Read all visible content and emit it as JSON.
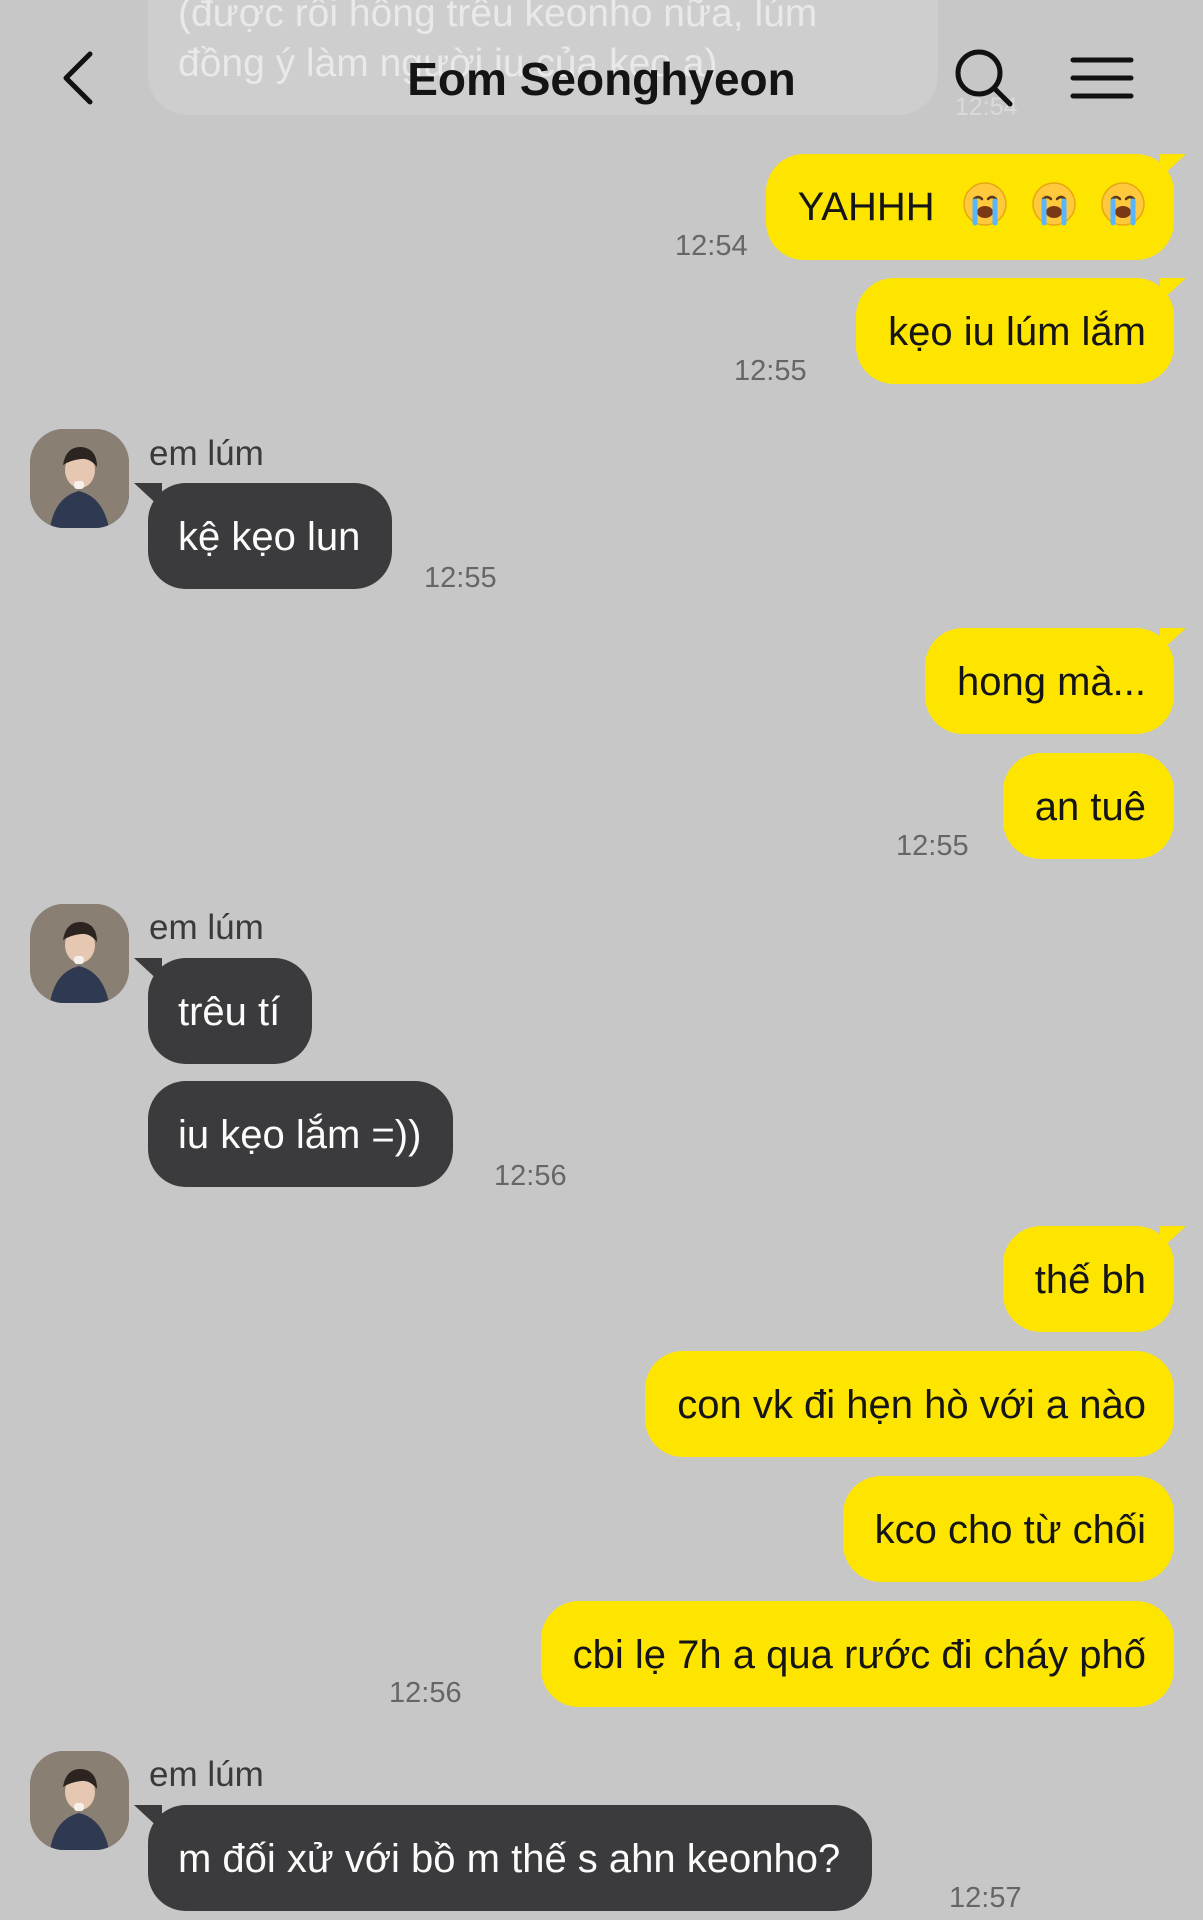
{
  "header": {
    "title": "Eom Seonghyeon",
    "ghost_message": "(được rồi hông trêu keonho nữa, lúm đồng ý làm người iu của kẹo a)",
    "ghost_time": "12:54"
  },
  "messages": [
    {
      "id": "m1",
      "sender": "me",
      "text": "YAHHH",
      "emoji": [
        "😭",
        "😭",
        "😭"
      ],
      "time": "12:54"
    },
    {
      "id": "m2",
      "sender": "me",
      "text": "kẹo iu lúm lắm",
      "time": "12:55"
    },
    {
      "id": "m3",
      "sender": "them",
      "name": "em lúm",
      "text": "kệ kẹo lun",
      "time": "12:55"
    },
    {
      "id": "m4",
      "sender": "me",
      "text": "hong mà..."
    },
    {
      "id": "m5",
      "sender": "me",
      "text": "an tuê",
      "time": "12:55"
    },
    {
      "id": "m6",
      "sender": "them",
      "name": "em lúm",
      "text": "trêu tí"
    },
    {
      "id": "m7",
      "sender": "them",
      "text": "iu kẹo lắm =))",
      "time": "12:56"
    },
    {
      "id": "m8",
      "sender": "me",
      "text": "thế bh"
    },
    {
      "id": "m9",
      "sender": "me",
      "text": "con vk đi hẹn hò với a nào"
    },
    {
      "id": "m10",
      "sender": "me",
      "text": "kco cho từ chối"
    },
    {
      "id": "m11",
      "sender": "me",
      "text": "cbi lẹ 7h a qua rước đi cháy phố",
      "time": "12:56"
    },
    {
      "id": "m12",
      "sender": "them",
      "name": "em lúm",
      "text": "m đối xử với bồ m thế s ahn keonho?",
      "time": "12:57"
    }
  ],
  "colors": {
    "background": "#c7c7c7",
    "outgoing_bubble": "#fee500",
    "incoming_bubble": "#3b3b3d"
  },
  "icons": {
    "back": "chevron-left-icon",
    "search": "search-icon",
    "menu": "hamburger-menu-icon",
    "avatar": "profile-photo"
  }
}
